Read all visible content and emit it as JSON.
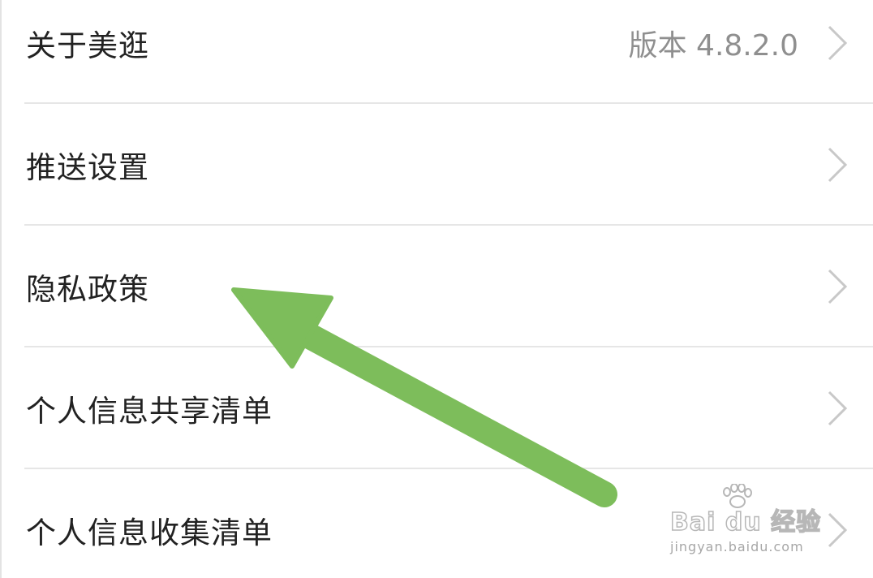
{
  "settings": {
    "items": [
      {
        "label": "关于美逛",
        "value": "版本 4.8.2.0"
      },
      {
        "label": "推送设置",
        "value": ""
      },
      {
        "label": "隐私政策",
        "value": ""
      },
      {
        "label": "个人信息共享清单",
        "value": ""
      },
      {
        "label": "个人信息收集清单",
        "value": ""
      }
    ]
  },
  "annotation": {
    "arrow_color": "#7dbd5b"
  },
  "watermark": {
    "brand": "Bai du 经验",
    "url": "jingyan.baidu.com"
  },
  "icons": {
    "row_chevron": "chevron-right-icon",
    "watermark_logo": "baidu-paw-icon"
  }
}
